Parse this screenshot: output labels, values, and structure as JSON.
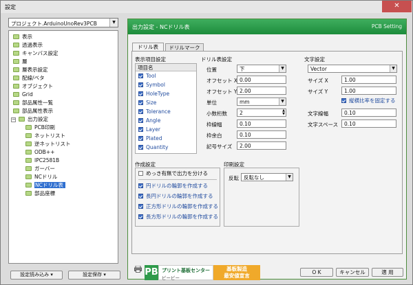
{
  "window": {
    "title": "設定",
    "close_glyph": "✕"
  },
  "left": {
    "project": "プロジェクト.ArduinoUnoRev3PCB",
    "tree": [
      {
        "label": "表示"
      },
      {
        "label": "透過表示"
      },
      {
        "label": "キャンバス設定"
      },
      {
        "label": "層"
      },
      {
        "label": "層表示設定"
      },
      {
        "label": "配線/ベタ"
      },
      {
        "label": "オブジェクト"
      },
      {
        "label": "Grid"
      },
      {
        "label": "部品属性一覧"
      },
      {
        "label": "部品属性表示"
      },
      {
        "label": "出力設定",
        "expander": "−"
      },
      {
        "label": "PCB印刷"
      },
      {
        "label": "ネットリスト"
      },
      {
        "label": "逆ネットリスト"
      },
      {
        "label": "ODB++"
      },
      {
        "label": "IPC2581B"
      },
      {
        "label": "ガーバー"
      },
      {
        "label": "NCドリル"
      },
      {
        "label": "NCドリル表"
      },
      {
        "label": "部品座標"
      }
    ],
    "btn_load": "設定読み込み ▾",
    "btn_save": "設定保存 ▾"
  },
  "panel": {
    "title": "出力設定 - NCドリル表",
    "tag": "PCB Setting",
    "tabs": [
      "ドリル表",
      "ドリルマーク"
    ],
    "items_section": "表示項目設定",
    "items_header": "項目名",
    "items": [
      "Tool",
      "Symbol",
      "HoleType",
      "Size",
      "Tolerance",
      "Angle",
      "Layer",
      "Plated",
      "Quantity"
    ],
    "drill_section": "ドリル表設定",
    "drill_fields": [
      {
        "label": "位置",
        "value": "下"
      },
      {
        "label": "オフセット X",
        "value": "0.00"
      },
      {
        "label": "オフセット Y",
        "value": "2.00"
      },
      {
        "label": "単位",
        "value": "mm"
      },
      {
        "label": "小数桁数",
        "value": "2"
      },
      {
        "label": "枠線幅",
        "value": "0.10"
      },
      {
        "label": "枠余白",
        "value": "0.10"
      },
      {
        "label": "記号サイズ",
        "value": "2.00"
      }
    ],
    "text_section": "文字設定",
    "font": "Vector",
    "text_fields": [
      {
        "label": "サイズ X",
        "value": "1.00"
      },
      {
        "label": "サイズ Y",
        "value": "1.00"
      },
      {
        "label": "文字線幅",
        "value": "0.10"
      },
      {
        "label": "文字スペース",
        "value": "0.10"
      }
    ],
    "keep_ratio": "縦横比率を固定する",
    "create_section": "作成設定",
    "split_plating": "めっき有無で出力を分ける",
    "create_items": [
      "円ドリルの輪郭を作成する",
      "長円ドリルの輪郭を作成する",
      "正方形ドリルの輪郭を作成する",
      "長方形ドリルの輪郭を作成する"
    ],
    "print_section": "印刷設定",
    "flip_label": "反転",
    "flip_value": "反転なし"
  },
  "ad": {
    "logo": "PB",
    "line1": "プリント基板センター",
    "line2": "ピーピー",
    "right1": "基板製造",
    "right2": "最安値宣言"
  },
  "buttons": {
    "ok": "O K",
    "cancel": "キャンセル",
    "apply": "適 用"
  }
}
